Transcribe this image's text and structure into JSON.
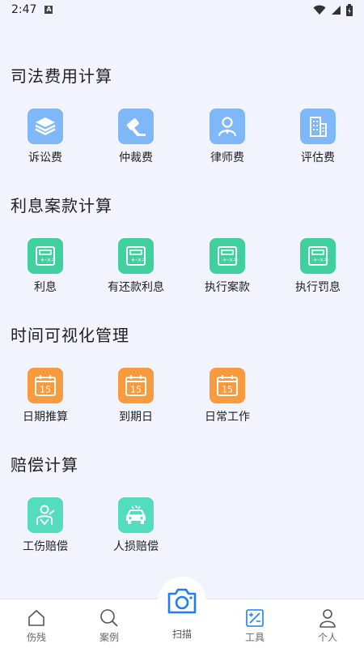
{
  "status_bar": {
    "time": "2:47",
    "notif_letter": "A"
  },
  "sections": [
    {
      "title": "司法费用计算",
      "items": [
        {
          "label": "诉讼费",
          "icon": "stack-icon",
          "color": "#7fb8f8"
        },
        {
          "label": "仲裁费",
          "icon": "gavel-icon",
          "color": "#7fb8f8"
        },
        {
          "label": "律师费",
          "icon": "lawyer-icon",
          "color": "#7fb8f8"
        },
        {
          "label": "评估费",
          "icon": "building-icon",
          "color": "#7fb8f8"
        }
      ]
    },
    {
      "title": "利息案款计算",
      "items": [
        {
          "label": "利息",
          "icon": "calculator-icon",
          "color": "#3fd09e"
        },
        {
          "label": "有还款利息",
          "icon": "calculator-icon",
          "color": "#3fd09e"
        },
        {
          "label": "执行案款",
          "icon": "calculator-icon",
          "color": "#3fd09e"
        },
        {
          "label": "执行罚息",
          "icon": "calculator-icon",
          "color": "#3fd09e"
        }
      ]
    },
    {
      "title": "时间可视化管理",
      "items": [
        {
          "label": "日期推算",
          "icon": "calendar-icon",
          "calendar_day": "15",
          "color": "#fa9a3f"
        },
        {
          "label": "到期日",
          "icon": "calendar-icon",
          "calendar_day": "15",
          "color": "#fa9a3f"
        },
        {
          "label": "日常工作",
          "icon": "calendar-icon",
          "calendar_day": "15",
          "color": "#fa9a3f"
        }
      ]
    },
    {
      "title": "赔偿计算",
      "items": [
        {
          "label": "工伤赔偿",
          "icon": "injured-worker-icon",
          "color": "#53dcbd"
        },
        {
          "label": "人损赔偿",
          "icon": "car-accident-icon",
          "color": "#53dcbd"
        }
      ]
    }
  ],
  "tab_bar": {
    "tabs": [
      {
        "label": "伤残",
        "icon": "home-icon",
        "active": false
      },
      {
        "label": "案例",
        "icon": "search-icon",
        "active": false
      },
      {
        "label": "扫描",
        "icon": "camera-icon",
        "active": false
      },
      {
        "label": "工具",
        "icon": "tools-icon",
        "active": true
      },
      {
        "label": "个人",
        "icon": "person-icon",
        "active": false
      }
    ],
    "active_color": "#1b7ef2"
  }
}
